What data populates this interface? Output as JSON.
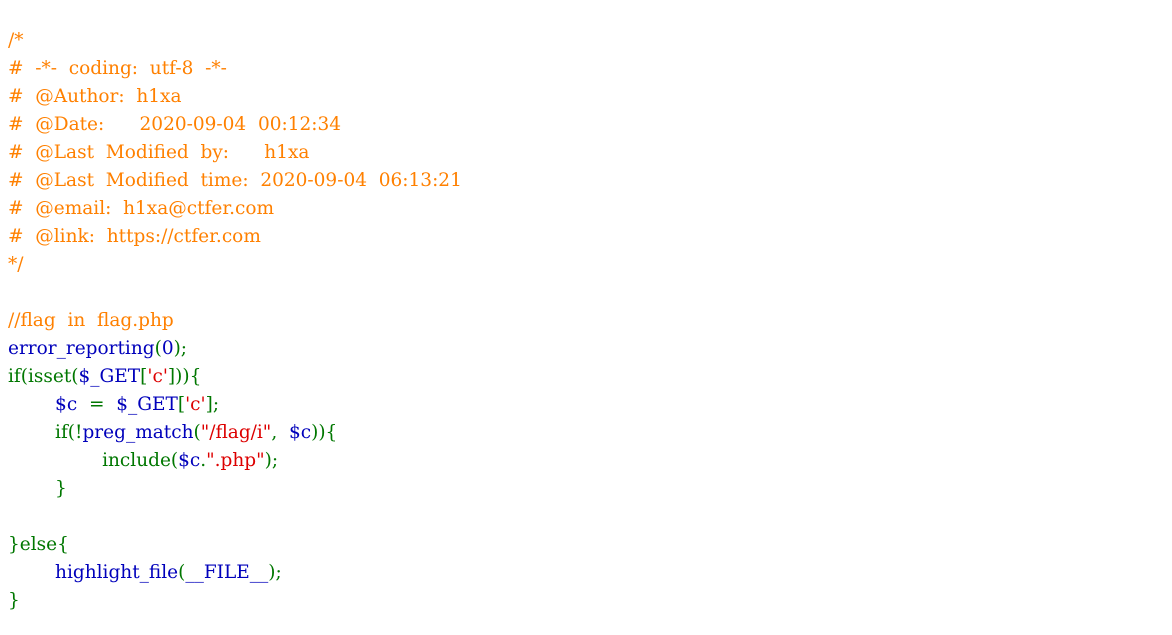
{
  "colors": {
    "comment": "#FF8000",
    "default": "#0000BB",
    "keyword": "#007700",
    "string": "#DD0000",
    "background": "#FFFFFF"
  },
  "code_lines": [
    {
      "tokens": [
        {
          "text": "/*",
          "type": "comment"
        }
      ]
    },
    {
      "tokens": [
        {
          "text": "#  -*-  coding:  utf-8  -*-",
          "type": "comment"
        }
      ]
    },
    {
      "tokens": [
        {
          "text": "#  @Author:  h1xa",
          "type": "comment"
        }
      ]
    },
    {
      "tokens": [
        {
          "text": "#  @Date:      2020-09-04  00:12:34",
          "type": "comment"
        }
      ]
    },
    {
      "tokens": [
        {
          "text": "#  @Last  Modified  by:      h1xa",
          "type": "comment"
        }
      ]
    },
    {
      "tokens": [
        {
          "text": "#  @Last  Modified  time:  2020-09-04  06:13:21",
          "type": "comment"
        }
      ]
    },
    {
      "tokens": [
        {
          "text": "#  @email:  h1xa@ctfer.com",
          "type": "comment"
        }
      ]
    },
    {
      "tokens": [
        {
          "text": "#  @link:  https://ctfer.com",
          "type": "comment"
        }
      ]
    },
    {
      "tokens": [
        {
          "text": "*/",
          "type": "comment"
        }
      ]
    },
    {
      "tokens": []
    },
    {
      "tokens": [
        {
          "text": "//flag  in  flag.php",
          "type": "comment"
        }
      ]
    },
    {
      "tokens": [
        {
          "text": "error_reporting",
          "type": "default"
        },
        {
          "text": "(",
          "type": "keyword"
        },
        {
          "text": "0",
          "type": "default"
        },
        {
          "text": ");",
          "type": "keyword"
        }
      ]
    },
    {
      "tokens": [
        {
          "text": "if(isset(",
          "type": "keyword"
        },
        {
          "text": "$_GET",
          "type": "default"
        },
        {
          "text": "[",
          "type": "keyword"
        },
        {
          "text": "'c'",
          "type": "string"
        },
        {
          "text": "])){",
          "type": "keyword"
        }
      ]
    },
    {
      "tokens": [
        {
          "text": "        ",
          "type": "keyword"
        },
        {
          "text": "$c  ",
          "type": "default"
        },
        {
          "text": "=  ",
          "type": "keyword"
        },
        {
          "text": "$_GET",
          "type": "default"
        },
        {
          "text": "[",
          "type": "keyword"
        },
        {
          "text": "'c'",
          "type": "string"
        },
        {
          "text": "];",
          "type": "keyword"
        }
      ]
    },
    {
      "tokens": [
        {
          "text": "        if(!",
          "type": "keyword"
        },
        {
          "text": "preg_match",
          "type": "default"
        },
        {
          "text": "(",
          "type": "keyword"
        },
        {
          "text": "\"/flag/i\"",
          "type": "string"
        },
        {
          "text": ",  ",
          "type": "keyword"
        },
        {
          "text": "$c",
          "type": "default"
        },
        {
          "text": ")){",
          "type": "keyword"
        }
      ]
    },
    {
      "tokens": [
        {
          "text": "                include(",
          "type": "keyword"
        },
        {
          "text": "$c",
          "type": "default"
        },
        {
          "text": ".",
          "type": "keyword"
        },
        {
          "text": "\".php\"",
          "type": "string"
        },
        {
          "text": ");",
          "type": "keyword"
        }
      ]
    },
    {
      "tokens": [
        {
          "text": "        }",
          "type": "keyword"
        }
      ]
    },
    {
      "tokens": []
    },
    {
      "tokens": [
        {
          "text": "}else{",
          "type": "keyword"
        }
      ]
    },
    {
      "tokens": [
        {
          "text": "        ",
          "type": "keyword"
        },
        {
          "text": "highlight_file",
          "type": "default"
        },
        {
          "text": "(",
          "type": "keyword"
        },
        {
          "text": "__FILE__",
          "type": "default"
        },
        {
          "text": ");",
          "type": "keyword"
        }
      ]
    },
    {
      "tokens": [
        {
          "text": "}",
          "type": "keyword"
        }
      ]
    }
  ]
}
